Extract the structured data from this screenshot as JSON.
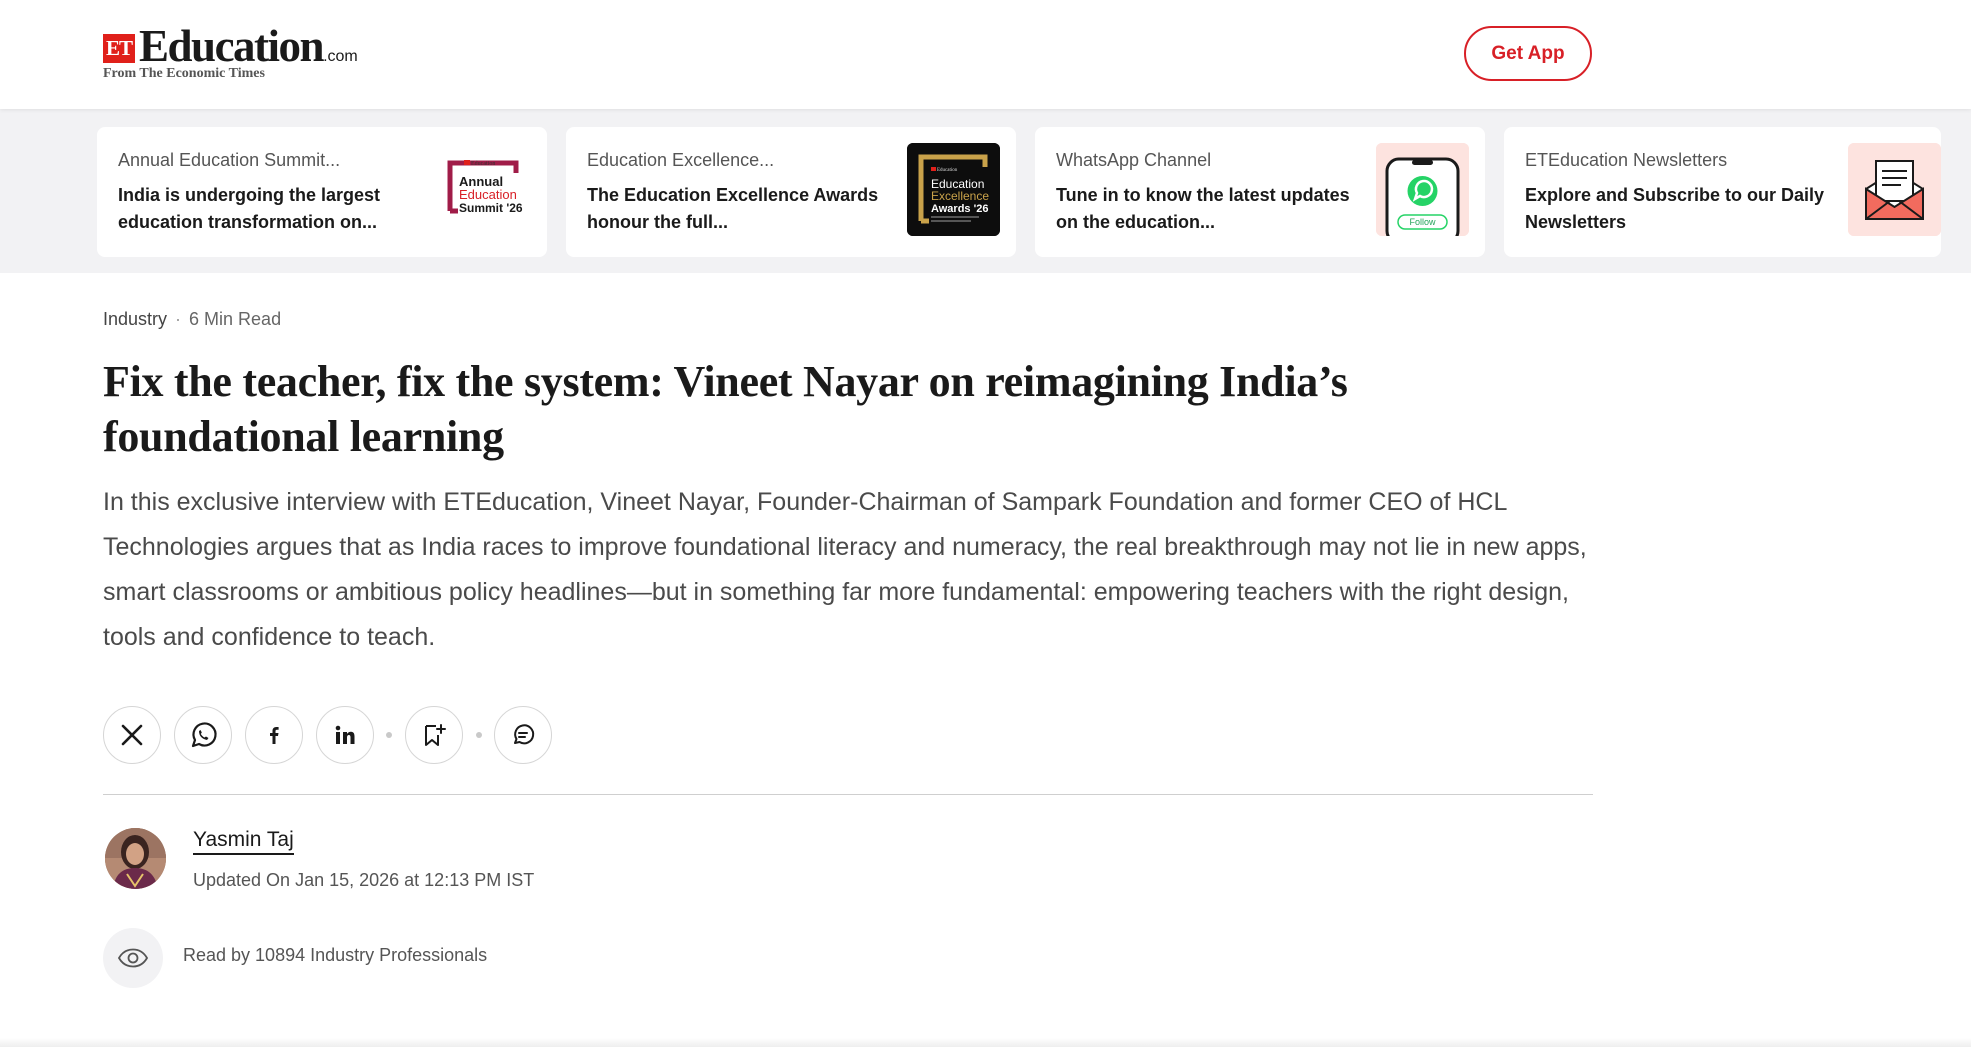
{
  "header": {
    "logo_et": "ET",
    "logo_main": "Education",
    "logo_com": ".com",
    "logo_sub": "From The Economic Times",
    "get_app_label": "Get App"
  },
  "promos": [
    {
      "kicker": "Annual Education Summit...",
      "text": "India is undergoing the largest education transformation on...",
      "thumb_icon": "summit-badge",
      "thumb_lines": [
        "Annual",
        "Education",
        "Summit '26"
      ]
    },
    {
      "kicker": "Education Excellence...",
      "text": "The Education Excellence Awards honour the full...",
      "thumb_icon": "awards-badge",
      "thumb_lines": [
        "Education",
        "Excellence",
        "Awards '26"
      ]
    },
    {
      "kicker": "WhatsApp Channel",
      "text": "Tune in to know the latest updates on the education...",
      "thumb_icon": "whatsapp-phone",
      "thumb_lines": [
        "Follow"
      ]
    },
    {
      "kicker": "ETEducation Newsletters",
      "text": "Explore and Subscribe to our Daily Newsletters",
      "thumb_icon": "envelope",
      "thumb_lines": []
    }
  ],
  "article": {
    "category": "Industry",
    "read_time": "6 Min Read",
    "title": "Fix the teacher, fix the system: Vineet Nayar on reimagining India’s foundational learning",
    "summary": "In this exclusive interview with ETEducation, Vineet Nayar, Founder-Chairman of Sampark Foundation and former CEO of HCL Technologies argues that as India races to improve foundational literacy and numeracy, the real breakthrough may not lie in new apps, smart classrooms or ambitious policy headlines—but in something far more fundamental: empowering teachers with the right design, tools and confidence to teach."
  },
  "share": {
    "icons": [
      "x-icon",
      "whatsapp-icon",
      "facebook-icon",
      "linkedin-icon",
      "bookmark-add-icon",
      "comment-icon"
    ]
  },
  "author": {
    "name": "Yasmin Taj",
    "updated": "Updated On Jan 15, 2026 at 12:13 PM IST"
  },
  "readership": {
    "text": "Read by 10894 Industry Professionals"
  },
  "colors": {
    "brand_red": "#d82027",
    "strip_bg": "#f2f2f4"
  }
}
